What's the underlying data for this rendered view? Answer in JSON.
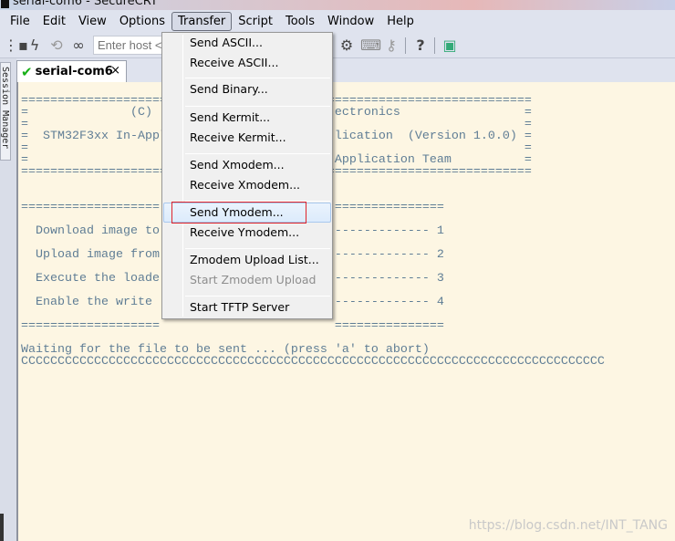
{
  "window": {
    "title": "serial-com6 - SecureCRT"
  },
  "menubar": [
    "File",
    "Edit",
    "View",
    "Options",
    "Transfer",
    "Script",
    "Tools",
    "Window",
    "Help"
  ],
  "toolbar": {
    "host_placeholder": "Enter host <Alt+R>",
    "icons": [
      "connect-bar-icon",
      "lightning-icon",
      "reconnect-icon",
      "link-icon",
      "gear-icon",
      "keyboard-icon",
      "key-icon",
      "help-icon",
      "lock-screen-icon"
    ]
  },
  "tab": {
    "label": "serial-com6",
    "close": "×"
  },
  "session_manager": "Session Manager",
  "terminal": {
    "lines": [
      "======================================================================",
      "=              (C)                         ectronics                 =",
      "=                                                                    =",
      "=  STM32F3xx In-Appl                       lication  (Version 1.0.0) =",
      "=                                                                    =",
      "=                                          Application Team          =",
      "======================================================================",
      "",
      "",
      "===================                        ===============",
      "",
      "  Download image to                        ------------- 1",
      "",
      "  Upload image from                        ------------- 2",
      "",
      "  Execute the loade                        ------------- 3",
      "",
      "  Enable the write                         ------------- 4",
      "",
      "===================                        ===============",
      "",
      "Waiting for the file to be sent ... (press 'a' to abort)",
      "CCCCCCCCCCCCCCCCCCCCCCCCCCCCCCCCCCCCCCCCCCCCCCCCCCCCCCCCCCCCCCCCCCCCCCCCCCCCCCCC"
    ]
  },
  "transfer_menu": {
    "items": [
      {
        "label": "Send ASCII..."
      },
      {
        "label": "Receive ASCII..."
      },
      {
        "label": "Send Binary..."
      },
      {
        "label": "Send Kermit..."
      },
      {
        "label": "Receive Kermit..."
      },
      {
        "label": "Send Xmodem..."
      },
      {
        "label": "Receive Xmodem..."
      },
      {
        "label": "Send Ymodem...",
        "highlighted": true
      },
      {
        "label": "Receive Ymodem..."
      },
      {
        "label": "Zmodem Upload List..."
      },
      {
        "label": "Start Zmodem Upload",
        "disabled": true
      },
      {
        "label": "Start TFTP Server"
      }
    ]
  },
  "watermark": "https://blog.csdn.net/INT_TANG",
  "colors": {
    "terminal_bg": "#fdf6e3",
    "terminal_text": "#5f7d95",
    "highlight_box": "#e0242a"
  }
}
